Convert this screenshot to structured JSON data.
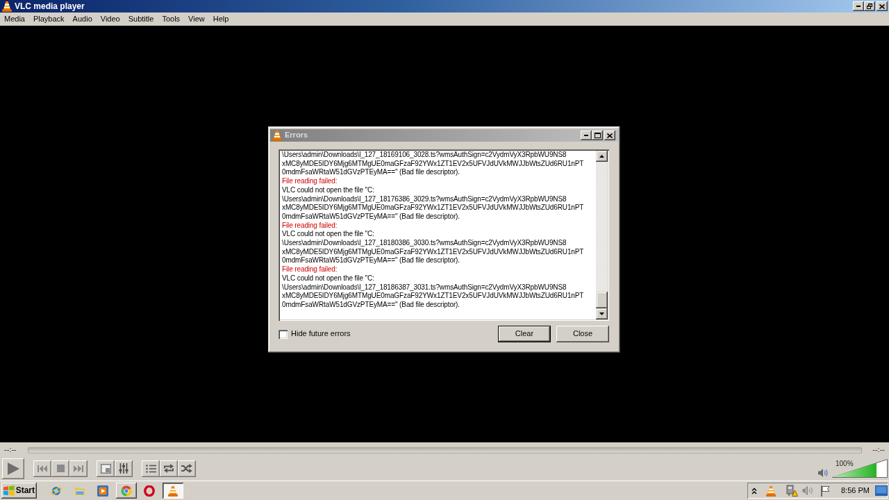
{
  "window": {
    "title": "VLC media player"
  },
  "menu": [
    "Media",
    "Playback",
    "Audio",
    "Video",
    "Subtitle",
    "Tools",
    "View",
    "Help"
  ],
  "errors_dialog": {
    "title": "Errors",
    "log": [
      {
        "kind": "message",
        "lines": [
          "\\Users\\admin\\Downloads\\l_127_18169106_3028.ts?wmsAuthSign=c2VydmVyX3RpbWU9NS8",
          "xMC8yMDE5IDY6Mjg6MTMgUE0maGFzaF92YWx1ZT1EV2x5UFVJdUVkMWJJbWtsZUd6RU1nPT",
          "0mdmFsaWRtaW51dGVzPTEyMA==\" (Bad file descriptor)."
        ]
      },
      {
        "kind": "error",
        "lines": [
          "File reading failed:"
        ]
      },
      {
        "kind": "message",
        "lines": [
          "VLC could not open the file \"C:",
          "\\Users\\admin\\Downloads\\l_127_18176386_3029.ts?wmsAuthSign=c2VydmVyX3RpbWU9NS8",
          "xMC8yMDE5IDY6Mjg6MTMgUE0maGFzaF92YWx1ZT1EV2x5UFVJdUVkMWJJbWtsZUd6RU1nPT",
          "0mdmFsaWRtaW51dGVzPTEyMA==\" (Bad file descriptor)."
        ]
      },
      {
        "kind": "error",
        "lines": [
          "File reading failed:"
        ]
      },
      {
        "kind": "message",
        "lines": [
          "VLC could not open the file \"C:",
          "\\Users\\admin\\Downloads\\l_127_18180386_3030.ts?wmsAuthSign=c2VydmVyX3RpbWU9NS8",
          "xMC8yMDE5IDY6Mjg6MTMgUE0maGFzaF92YWx1ZT1EV2x5UFVJdUVkMWJJbWtsZUd6RU1nPT",
          "0mdmFsaWRtaW51dGVzPTEyMA==\" (Bad file descriptor)."
        ]
      },
      {
        "kind": "error",
        "lines": [
          "File reading failed:"
        ]
      },
      {
        "kind": "message",
        "lines": [
          "VLC could not open the file \"C:",
          "\\Users\\admin\\Downloads\\l_127_18186387_3031.ts?wmsAuthSign=c2VydmVyX3RpbWU9NS8",
          "xMC8yMDE5IDY6Mjg6MTMgUE0maGFzaF92YWx1ZT1EV2x5UFVJdUVkMWJJbWtsZUd6RU1nPT",
          "0mdmFsaWRtaW51dGVzPTEyMA==\" (Bad file descriptor)."
        ]
      }
    ],
    "hide_future_errors": {
      "label": "Hide future errors",
      "checked": false
    },
    "buttons": [
      {
        "label": "Clear",
        "default": true
      },
      {
        "label": "Close",
        "default": false
      }
    ]
  },
  "player": {
    "elapsed": "--:--",
    "remaining": "--:--",
    "volume": {
      "level": 0.8,
      "reading": "100%"
    }
  },
  "taskbar": {
    "start": "Start",
    "apps": [
      {
        "kind": "globe",
        "running": false,
        "selected": false
      },
      {
        "kind": "folder",
        "running": false,
        "selected": false
      },
      {
        "kind": "player",
        "running": false,
        "selected": false
      },
      {
        "kind": "browser",
        "running": true,
        "selected": false
      },
      {
        "kind": "ring",
        "running": false,
        "selected": false
      },
      {
        "kind": "cone",
        "running": true,
        "selected": true
      }
    ],
    "clock": "8:56 PM"
  }
}
